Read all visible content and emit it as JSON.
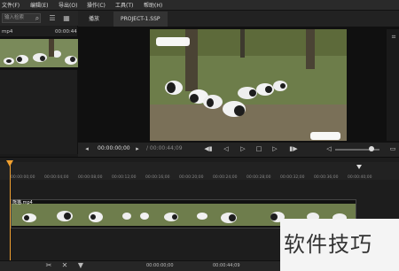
{
  "menubar": {
    "items": [
      "文件(F)",
      "编辑(E)",
      "导出(O)",
      "操作(C)",
      "工具(T)",
      "帮助(H)"
    ]
  },
  "media": {
    "search_placeholder": "输入检索",
    "clip_name": "mp4",
    "clip_duration": "00:00:44"
  },
  "tabs": {
    "media_tab": "播放",
    "project_tab": "PROJECT-1.SSP"
  },
  "player": {
    "timecode": "00:00:00;00",
    "total": "/ 00:00:44;09"
  },
  "timeline": {
    "ticks": [
      "00:00:00;00",
      "00:00:04;00",
      "00:00:08;00",
      "00:00:12;00",
      "00:00:16;00",
      "00:00:20;00",
      "00:00:24;00",
      "00:00:28;00",
      "00:00:32;00",
      "00:00:36;00",
      "00:00:40;00"
    ],
    "track_label": "熊猫.mp4"
  },
  "bottombar": {
    "left_tc": "00:00:00;00",
    "right_tc": "00:00:44;09"
  },
  "watermark": "软件技巧"
}
